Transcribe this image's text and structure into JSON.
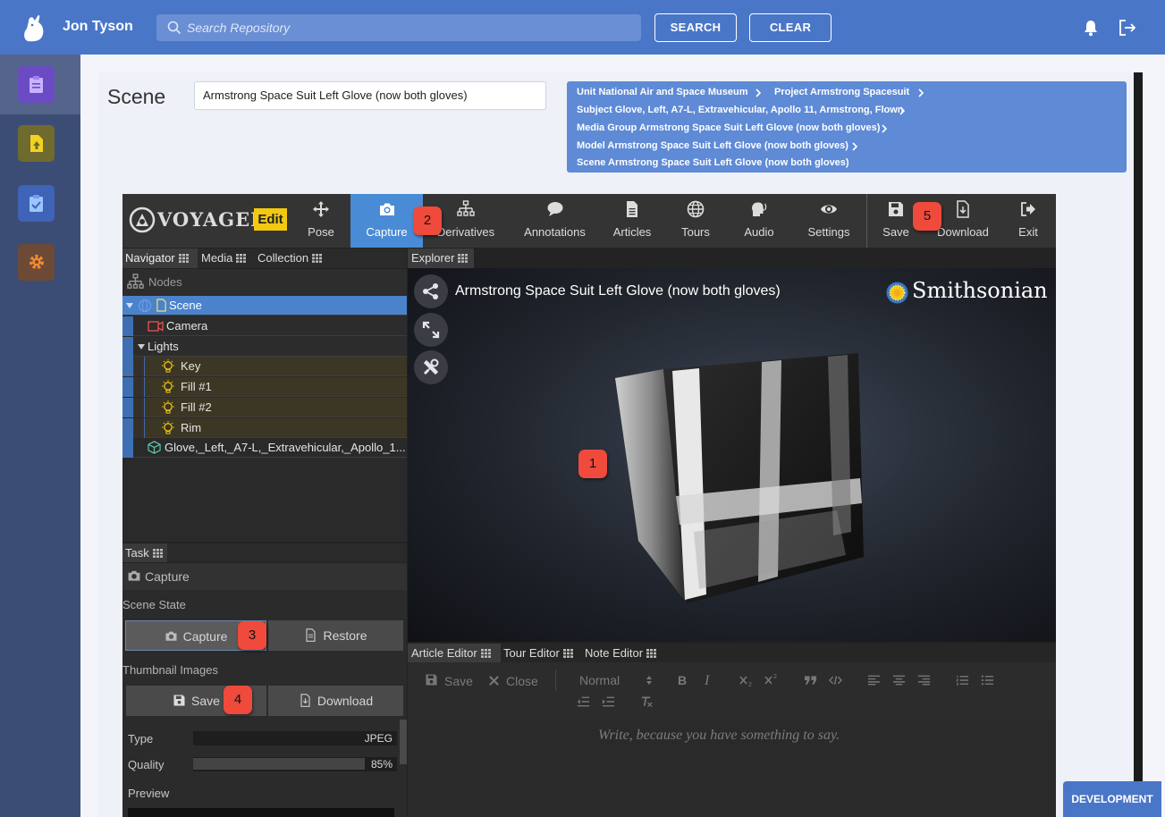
{
  "header": {
    "user_name": "Jon Tyson",
    "search_placeholder": "Search Repository",
    "search_button": "SEARCH",
    "clear_button": "CLEAR"
  },
  "page": {
    "title": "Scene",
    "scene_name": "Armstrong Space Suit Left Glove (now both gloves)"
  },
  "breadcrumbs": [
    {
      "label": "Unit National Air and Space Museum"
    },
    {
      "label": "Project Armstrong Spacesuit"
    },
    {
      "label": "Subject Glove, Left, A7-L, Extravehicular, Apollo 11, Armstrong, Flown"
    },
    {
      "label": "Media Group Armstrong Space Suit Left Glove (now both gloves)"
    },
    {
      "label": "Model Armstrong Space Suit Left Glove (now both gloves)"
    },
    {
      "label": "Scene Armstrong Space Suit Left Glove (now both gloves)"
    }
  ],
  "voyager": {
    "logo_text": "VOYAGER",
    "mode_badge": "Edit",
    "tools": {
      "pose": "Pose",
      "capture": "Capture",
      "derivatives": "Derivatives",
      "annotations": "Annotations",
      "articles": "Articles",
      "tours": "Tours",
      "audio": "Audio",
      "settings": "Settings",
      "save": "Save",
      "download": "Download",
      "exit": "Exit"
    },
    "active_tool": "capture"
  },
  "navigator": {
    "tabs": {
      "navigator": "Navigator",
      "media": "Media",
      "collection": "Collection"
    },
    "nodes_header": "Nodes",
    "tree": {
      "scene": "Scene",
      "camera": "Camera",
      "lights": "Lights",
      "key": "Key",
      "fill1": "Fill #1",
      "fill2": "Fill #2",
      "rim": "Rim",
      "model": "Glove,_Left,_A7-L,_Extravehicular,_Apollo_1..."
    }
  },
  "task": {
    "tab": "Task",
    "header": "Capture",
    "scene_state_label": "Scene State",
    "capture_button": "Capture",
    "restore_button": "Restore",
    "thumbnail_label": "Thumbnail Images",
    "save_button": "Save",
    "download_button": "Download",
    "type_label": "Type",
    "type_value": "JPEG",
    "quality_label": "Quality",
    "quality_value": "85%",
    "quality_fraction": 0.85,
    "preview_label": "Preview"
  },
  "explorer": {
    "tab": "Explorer",
    "title": "Armstrong Space Suit Left Glove (now both gloves)",
    "brand": "Smithsonian"
  },
  "editor": {
    "tabs": {
      "article": "Article Editor",
      "tour": "Tour Editor",
      "note": "Note Editor"
    },
    "save": "Save",
    "close": "Close",
    "format": "Normal",
    "bold": "B",
    "italic": "I",
    "placeholder": "Write, because you have something to say."
  },
  "badges": {
    "b1": "1",
    "b2": "2",
    "b3": "3",
    "b4": "4",
    "b5": "5"
  },
  "environment_badge": "DEVELOPMENT",
  "colors": {
    "header_blue": "#4a76c8",
    "sidebar": "#3c4d75",
    "voyager_accent": "#4a8bd6",
    "callout_red": "#ef4a3b",
    "edit_yellow": "#f2c811"
  }
}
